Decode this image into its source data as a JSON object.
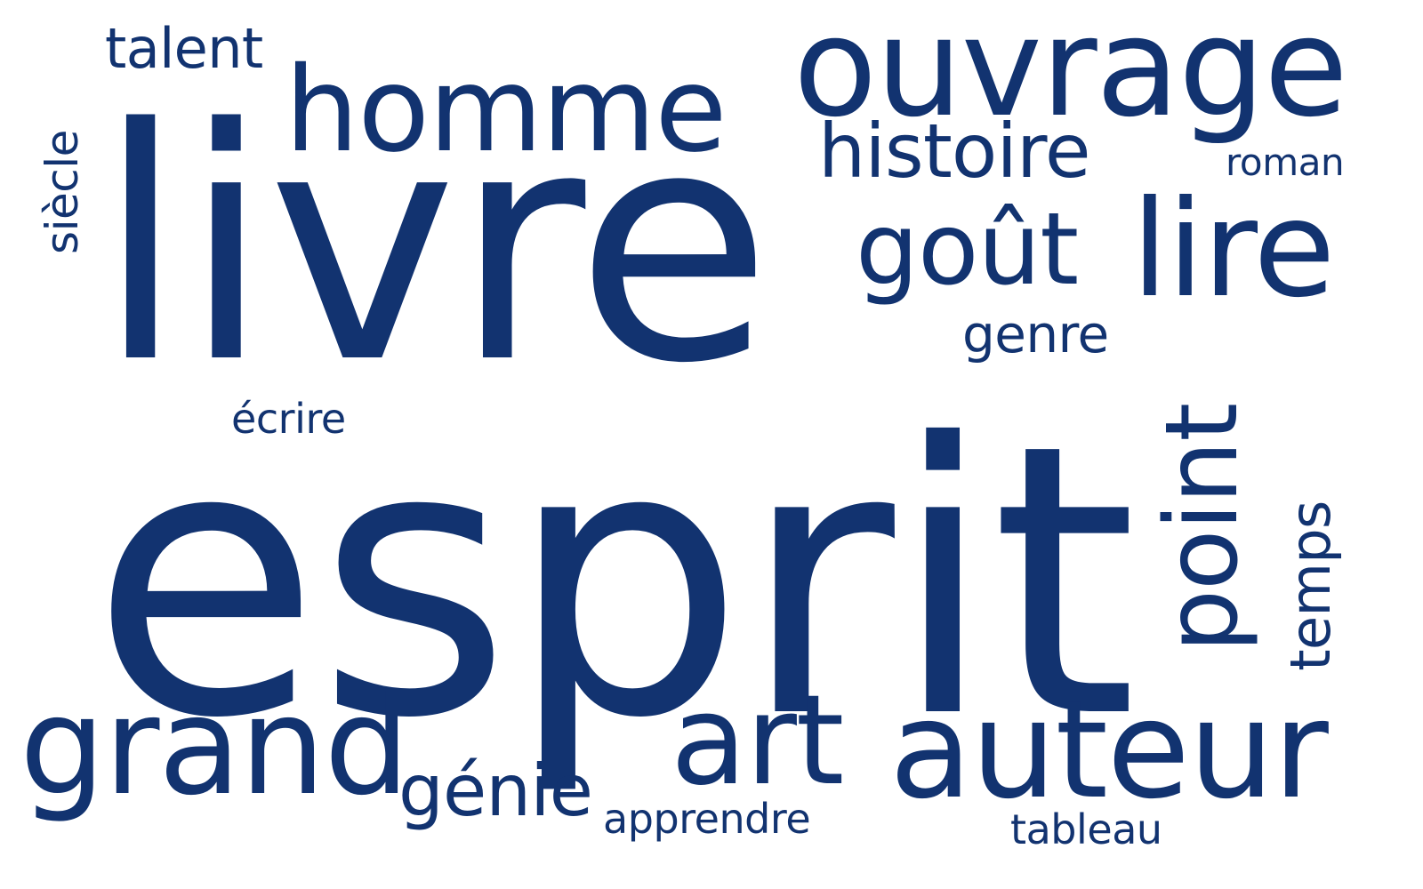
{
  "theme": {
    "word_color": "#123370",
    "background": "#ffffff"
  },
  "words": {
    "livre": "livre",
    "esprit": "esprit",
    "homme": "homme",
    "ouvrage": "ouvrage",
    "talent": "talent",
    "siecle": "siècle",
    "histoire": "histoire",
    "roman": "roman",
    "gout": "goût",
    "lire": "lire",
    "genre": "genre",
    "ecrire": "écrire",
    "point": "point",
    "temps": "temps",
    "grand": "grand",
    "genie": "génie",
    "art": "art",
    "auteur": "auteur",
    "apprendre": "apprendre",
    "tableau": "tableau"
  }
}
